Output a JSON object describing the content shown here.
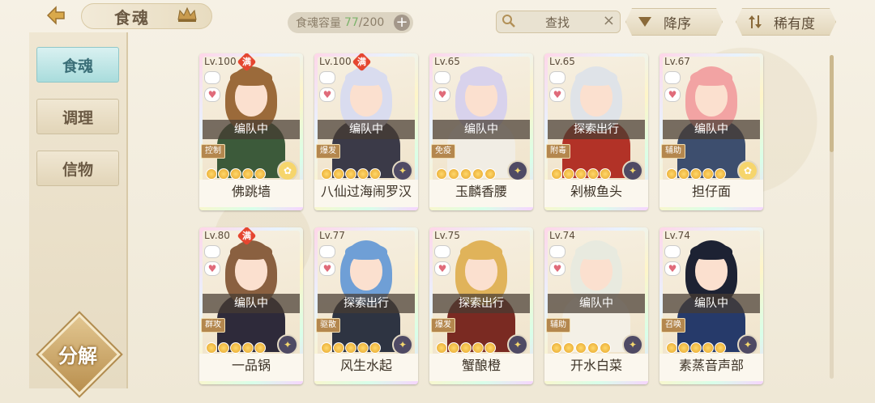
{
  "header": {
    "title": "食魂",
    "capacity_label": "食魂容量",
    "capacity_current": "77",
    "capacity_max": "/200",
    "capacity_add": "+",
    "search_placeholder": "查找",
    "search_clear": "×",
    "sort_order": "降序",
    "sort_key": "稀有度"
  },
  "sidebar": {
    "items": [
      {
        "label": "食魂",
        "active": true
      },
      {
        "label": "调理",
        "active": false
      },
      {
        "label": "信物",
        "active": false
      }
    ],
    "decompose_label": "分解"
  },
  "colors": {
    "background": "#f4efe2",
    "active_tab": "#a9dcdc",
    "full_badge": "#e54630",
    "capacity_current": "#7bb36a"
  },
  "cards": [
    {
      "level": "Lv.100",
      "full": "满",
      "status": "编队中",
      "role": "控制",
      "name": "佛跳墙",
      "element": "gold",
      "hair": "#9b6a3a",
      "body": "#3c5a3a"
    },
    {
      "level": "Lv.100",
      "full": "满",
      "status": "编队中",
      "role": "爆发",
      "name": "八仙过海闹罗汉",
      "element": "dark",
      "hair": "#d9dcef",
      "body": "#3b3a48"
    },
    {
      "level": "Lv.65",
      "full": "",
      "status": "编队中",
      "role": "免疫",
      "name": "玉麟香腰",
      "element": "dark",
      "hair": "#d8d2ec",
      "body": "#f1ede4"
    },
    {
      "level": "Lv.65",
      "full": "",
      "status": "探索出行",
      "role": "附毒",
      "name": "剁椒鱼头",
      "element": "dark",
      "hair": "#dfe3e8",
      "body": "#b23227"
    },
    {
      "level": "Lv.67",
      "full": "",
      "status": "编队中",
      "role": "辅助",
      "name": "担仔面",
      "element": "gold",
      "hair": "#f2a3a3",
      "body": "#3d4e6e"
    },
    {
      "level": "Lv.80",
      "full": "满",
      "status": "编队中",
      "role": "群攻",
      "name": "一品锅",
      "element": "dark",
      "hair": "#8a6040",
      "body": "#2e2a3a"
    },
    {
      "level": "Lv.77",
      "full": "",
      "status": "探索出行",
      "role": "驱散",
      "name": "风生水起",
      "element": "dark",
      "hair": "#6f9fd6",
      "body": "#2e3442"
    },
    {
      "level": "Lv.75",
      "full": "",
      "status": "探索出行",
      "role": "爆发",
      "name": "蟹酿橙",
      "element": "dark",
      "hair": "#e0b35a",
      "body": "#7a2a22"
    },
    {
      "level": "Lv.74",
      "full": "",
      "status": "编队中",
      "role": "辅助",
      "name": "开水白菜",
      "element": "dark",
      "hair": "#e8eadf",
      "body": "#f4f0e6"
    },
    {
      "level": "Lv.74",
      "full": "",
      "status": "编队中",
      "role": "召唤",
      "name": "素蒸音声部",
      "element": "dark",
      "hair": "#1d2233",
      "body": "#263a6a"
    }
  ]
}
